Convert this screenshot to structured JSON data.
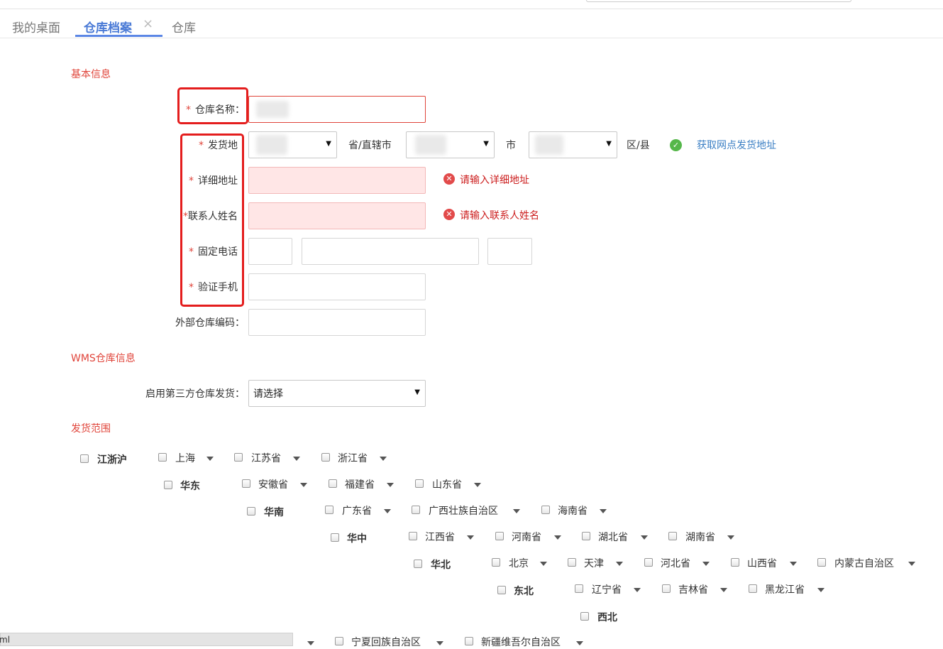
{
  "tabs": [
    {
      "label": "我的桌面",
      "active": false
    },
    {
      "label": "仓库档案",
      "active": true,
      "closable": true
    },
    {
      "label": "仓库",
      "active": false
    }
  ],
  "tab_close_symbol": "×",
  "sections": {
    "basic": "基本信息",
    "wms": "WMS仓库信息",
    "scope": "发货范围"
  },
  "form": {
    "required_mark": "*",
    "warehouse_name_label": "仓库名称：",
    "origin_label": "发货地",
    "province_suffix": "省/直辖市",
    "city_suffix": "市",
    "district_suffix": "区/县",
    "get_address_link": "获取网点发货地址",
    "detail_address_label": "详细地址",
    "detail_address_error": "请输入详细地址",
    "contact_label": "联系人姓名",
    "contact_error": "请输入联系人姓名",
    "phone_label": "固定电话",
    "mobile_label": "验证手机",
    "external_code_label": "外部仓库编码：",
    "third_party_label": "启用第三方仓库发货：",
    "third_party_value": "请选择"
  },
  "icons": {
    "error_icon": "✕",
    "ok_icon": "✓",
    "select_arrow": "▼"
  },
  "scope_rows": [
    {
      "region": "江浙沪",
      "provinces": [
        "上海",
        "江苏省",
        "浙江省"
      ]
    },
    {
      "region": "华东",
      "provinces": [
        "安徽省",
        "福建省",
        "山东省"
      ]
    },
    {
      "region": "华南",
      "provinces": [
        "广东省",
        "广西壮族自治区",
        "海南省"
      ]
    },
    {
      "region": "华中",
      "provinces": [
        "江西省",
        "河南省",
        "湖北省",
        "湖南省"
      ]
    },
    {
      "region": "华北",
      "provinces": [
        "北京",
        "天津",
        "河北省",
        "山西省",
        "内蒙古自治区"
      ]
    },
    {
      "region": "东北",
      "provinces": [
        "辽宁省",
        "吉林省",
        "黑龙江省"
      ]
    },
    {
      "region": "西北",
      "provinces": []
    },
    {
      "region": "",
      "provinces": [
        "宁夏回族自治区",
        "新疆维吾尔自治区"
      ]
    }
  ],
  "statusbar": {
    "text": "ml"
  },
  "colors": {
    "accent_red": "#e0443a",
    "active_tab": "#4a7ad6",
    "error_red": "#cc1e1e",
    "link_blue": "#3b7fc4",
    "ok_green": "#55b74a"
  }
}
